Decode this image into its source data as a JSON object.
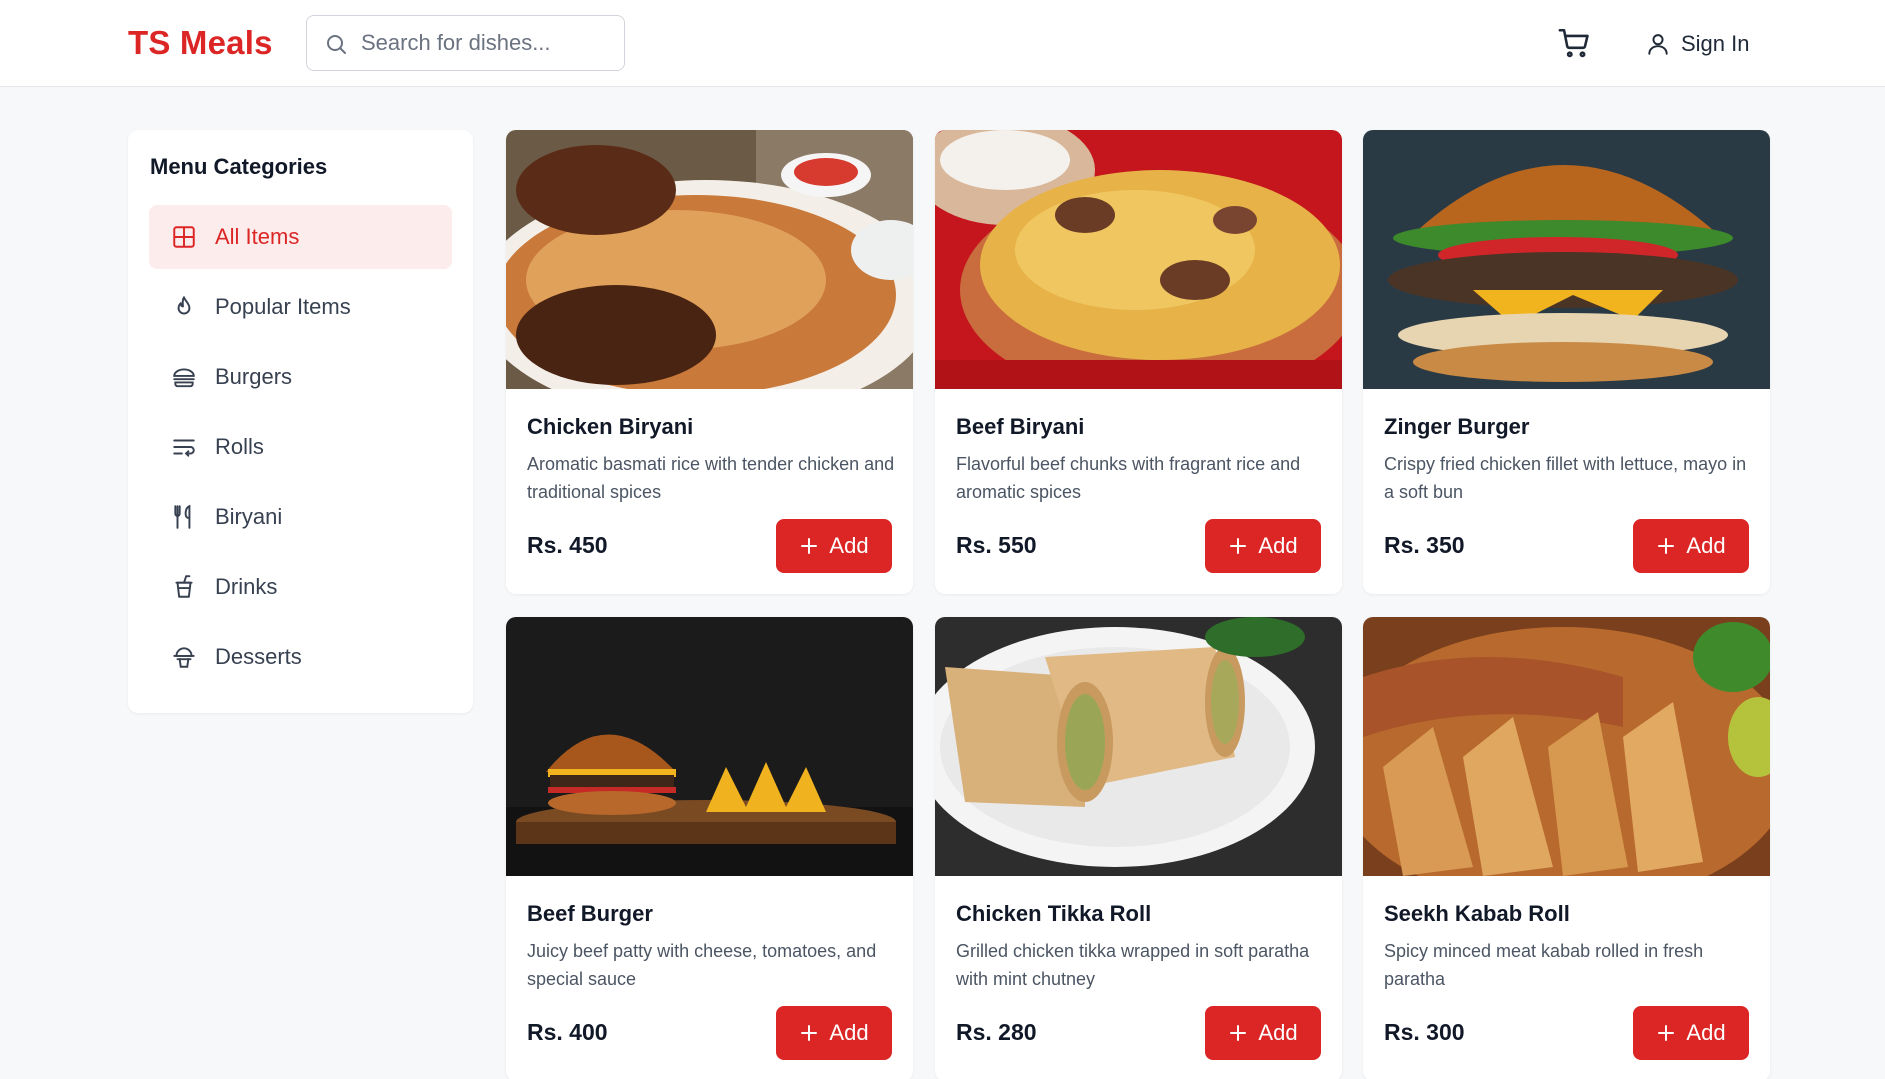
{
  "brand": {
    "name": "TS Meals",
    "color": "#dc2626"
  },
  "search": {
    "placeholder": "Search for dishes..."
  },
  "header": {
    "cart_icon": "cart-icon",
    "signin_label": "Sign In",
    "signin_icon": "user-icon"
  },
  "sidebar": {
    "title": "Menu Categories",
    "items": [
      {
        "label": "All Items",
        "icon": "grid-icon",
        "active": true
      },
      {
        "label": "Popular Items",
        "icon": "flame-icon",
        "active": false
      },
      {
        "label": "Burgers",
        "icon": "burger-icon",
        "active": false
      },
      {
        "label": "Rolls",
        "icon": "wrap-text-icon",
        "active": false
      },
      {
        "label": "Biryani",
        "icon": "utensils-icon",
        "active": false
      },
      {
        "label": "Drinks",
        "icon": "cup-icon",
        "active": false
      },
      {
        "label": "Desserts",
        "icon": "dessert-icon",
        "active": false
      }
    ]
  },
  "products": [
    {
      "name": "Chicken Biryani",
      "description": "Aromatic basmati rice with tender chicken and traditional spices",
      "price": "Rs. 450",
      "add_label": "Add",
      "image": "chicken-biryani-image"
    },
    {
      "name": "Beef Biryani",
      "description": "Flavorful beef chunks with fragrant rice and aromatic spices",
      "price": "Rs. 550",
      "add_label": "Add",
      "image": "beef-biryani-image"
    },
    {
      "name": "Zinger Burger",
      "description": "Crispy fried chicken fillet with lettuce, mayo in a soft bun",
      "price": "Rs. 350",
      "add_label": "Add",
      "image": "zinger-burger-image"
    },
    {
      "name": "Beef Burger",
      "description": "Juicy beef patty with cheese, tomatoes, and special sauce",
      "price": "Rs. 400",
      "add_label": "Add",
      "image": "beef-burger-image"
    },
    {
      "name": "Chicken Tikka Roll",
      "description": "Grilled chicken tikka wrapped in soft paratha with mint chutney",
      "price": "Rs. 280",
      "add_label": "Add",
      "image": "chicken-tikka-roll-image"
    },
    {
      "name": "Seekh Kabab Roll",
      "description": "Spicy minced meat kabab rolled in fresh paratha",
      "price": "Rs. 300",
      "add_label": "Add",
      "image": "seekh-kabab-roll-image"
    }
  ]
}
